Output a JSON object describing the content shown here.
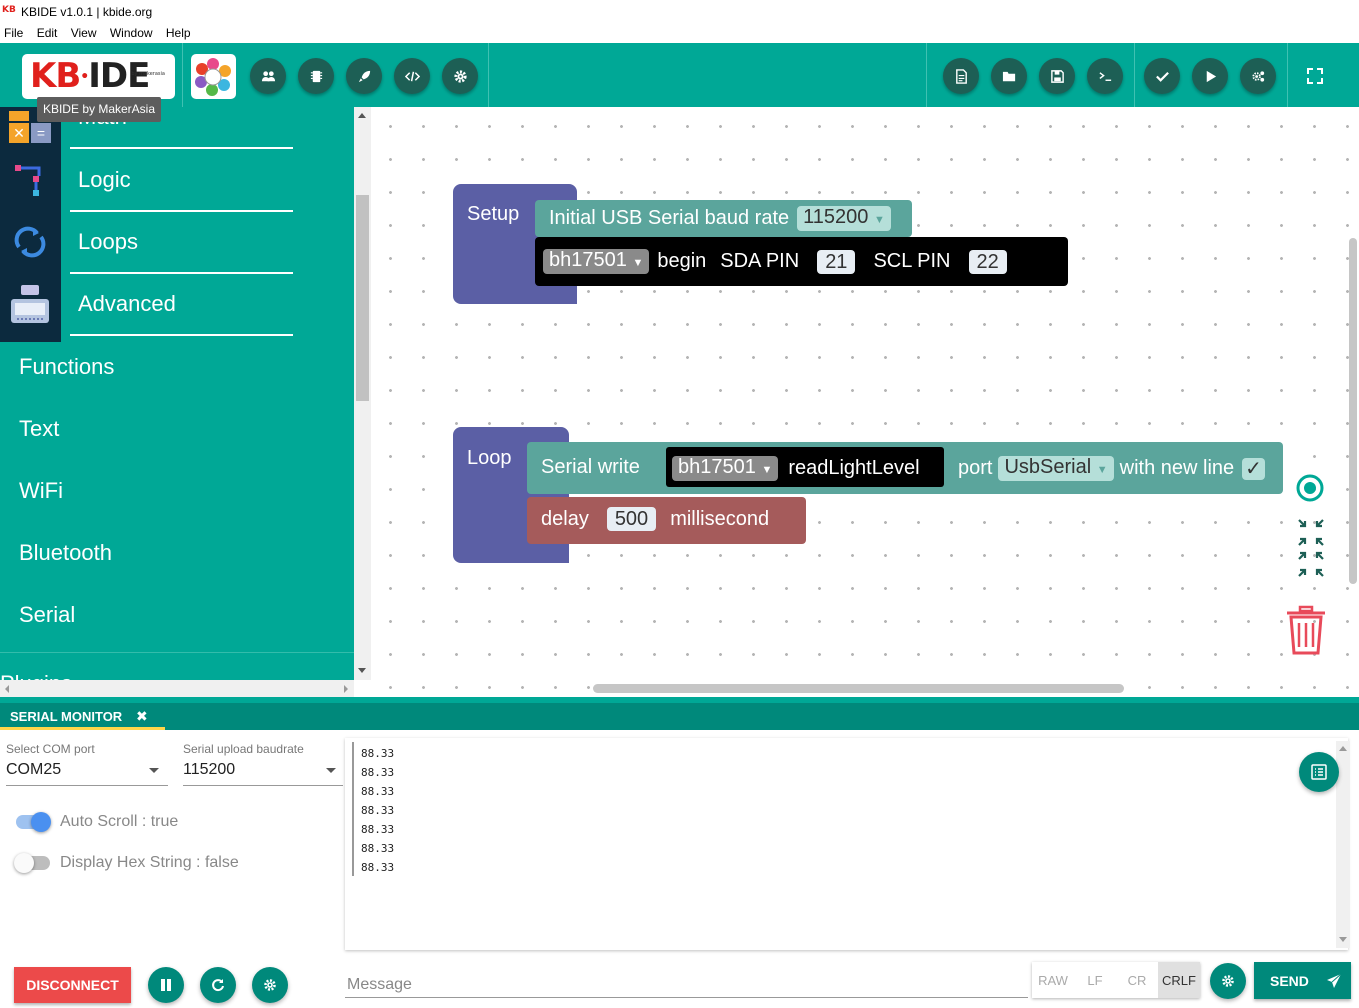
{
  "window": {
    "title": "KBIDE v1.0.1 | kbide.org",
    "icon_text": "KB"
  },
  "menu": [
    "File",
    "Edit",
    "View",
    "Window",
    "Help"
  ],
  "toolbar": {
    "logo_kb": "KB",
    "logo_ide": "IDE",
    "logo_by": "by makerasia",
    "tooltip": "KBIDE by MakerAsia",
    "left_buttons": [
      "users-icon",
      "chip-icon",
      "rocket-icon",
      "code-icon",
      "gear-icon"
    ],
    "right_buttons": [
      "new-file-icon",
      "open-folder-icon",
      "save-icon",
      "terminal-icon",
      "check-icon",
      "play-icon",
      "settings-cogs-icon"
    ],
    "fullscreen": "fullscreen-icon"
  },
  "sidebar": {
    "partial_top": "Math",
    "categories_icon": [
      "Logic",
      "Loops",
      "Advanced"
    ],
    "categories": [
      "Functions",
      "Text",
      "WiFi",
      "Bluetooth",
      "Serial"
    ],
    "partial_bottom": "Plugins"
  },
  "workspace": {
    "setup": {
      "label": "Setup",
      "serial_block": {
        "text": "Initial USB Serial baud rate",
        "baud": "115200"
      },
      "sensor_block": {
        "device": "bh17501",
        "begin": "begin",
        "sda_label": "SDA PIN",
        "sda": "21",
        "scl_label": "SCL PIN",
        "scl": "22"
      }
    },
    "loop": {
      "label": "Loop",
      "write_block": {
        "text": "Serial write",
        "device": "bh17501",
        "method": "readLightLevel",
        "port_label": "port",
        "port": "UsbSerial",
        "newline_label": "with new line",
        "newline_check": "✓"
      },
      "delay_block": {
        "text": "delay",
        "value": "500",
        "unit": "millisecond"
      }
    },
    "colors": {
      "hat": "#5b5fa5",
      "serial": "#5ba59c",
      "sensor": "#000000",
      "delay": "#a55b5b"
    }
  },
  "serial_monitor": {
    "tab_label": "SERIAL MONITOR",
    "close": "✖",
    "com_label": "Select COM port",
    "com_value": "COM25",
    "baud_label": "Serial upload baudrate",
    "baud_value": "115200",
    "auto_scroll": "Auto Scroll : true",
    "hex_string": "Display Hex String : false",
    "output": [
      "88.33",
      "88.33",
      "88.33",
      "88.33",
      "88.33",
      "88.33",
      "88.33"
    ],
    "disconnect": "DISCONNECT",
    "message_placeholder": "Message",
    "eol_options": [
      "RAW",
      "LF",
      "CR",
      "CRLF"
    ],
    "eol_selected": "CRLF",
    "send": "SEND"
  }
}
